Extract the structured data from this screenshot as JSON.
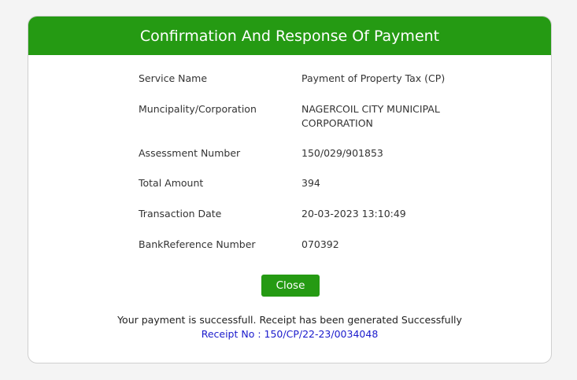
{
  "header": {
    "title": "Confirmation And Response Of Payment"
  },
  "details": {
    "service_name_label": "Service Name",
    "service_name_value": "Payment of Property Tax (CP)",
    "municipality_label": "Muncipality/Corporation",
    "municipality_value_line1": "NAGERCOIL CITY MUNICIPAL",
    "municipality_value_line2": "CORPORATION",
    "assessment_label": "Assessment Number",
    "assessment_value": "150/029/901853",
    "total_amount_label": "Total Amount",
    "total_amount_value": "394",
    "transaction_date_label": "Transaction Date",
    "transaction_date_value": "20-03-2023 13:10:49",
    "bank_ref_label": "BankReference Number",
    "bank_ref_value": "070392"
  },
  "actions": {
    "close_label": "Close"
  },
  "footer": {
    "success_message": "Your payment is successfull. Receipt has been generated Successfully",
    "receipt_text": "Receipt No : 150/CP/22-23/0034048"
  },
  "colors": {
    "header_bg": "#259a13",
    "button_bg": "#259a13",
    "receipt_text": "#1a1acc"
  }
}
